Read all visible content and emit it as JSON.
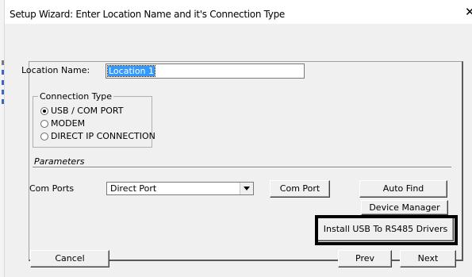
{
  "window": {
    "title": "Setup Wizard: Enter Location Name and it's Connection Type",
    "close_glyph": "✕"
  },
  "location": {
    "label": "Location Name:",
    "value": "Location 1"
  },
  "connection_type": {
    "legend": "Connection Type",
    "options": [
      {
        "label": "USB / COM PORT",
        "checked": true
      },
      {
        "label": "MODEM",
        "checked": false
      },
      {
        "label": "DIRECT IP CONNECTION",
        "checked": false
      }
    ]
  },
  "parameters": {
    "label": "Parameters",
    "com_ports_label": "Com Ports",
    "com_ports_value": "Direct Port",
    "com_port_button": "Com Port",
    "auto_find_button": "Auto Find",
    "device_manager_button": "Device Manager",
    "install_drivers_button": "Install USB To RS485 Drivers"
  },
  "footer": {
    "cancel": "Cancel",
    "prev": "Prev",
    "next": "Next"
  },
  "colors": {
    "dialog_bg": "#f0f0f0",
    "selection": "#3399ff",
    "highlight_frame": "#000000"
  }
}
